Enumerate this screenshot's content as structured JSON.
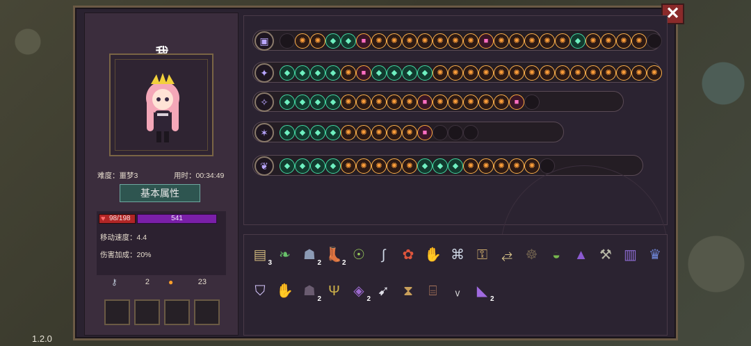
{
  "app": {
    "version": "1.2.0"
  },
  "header": {
    "player_name": "我"
  },
  "close": {
    "label": "✕"
  },
  "run_info": {
    "difficulty": "难度：噩梦3",
    "elapsed": "用时：00:34:49"
  },
  "attributes": {
    "title": "基本属性",
    "hp": "98/198",
    "mp": "541",
    "move_speed": "移动速度：4.4",
    "damage_bonus": "伤害加成：20%"
  },
  "resources": {
    "keys": "2",
    "coins": "23"
  },
  "colors": {
    "panel_bg": "#2a2230",
    "hp": "#b12626",
    "mp": "#7a1fa8",
    "accent_teal": "#2e5550"
  },
  "weapons": [
    {
      "icon": "chest-icon",
      "slots": 25
    },
    {
      "icon": "staff-icon",
      "slots": 25
    },
    {
      "icon": "wand-icon",
      "slots": 17
    },
    {
      "icon": "dark-wand-icon",
      "slots": 13
    },
    {
      "icon": "nature-staff-icon",
      "slots": 18
    }
  ],
  "items": [
    {
      "icon": "armor-chest-icon",
      "count": "3"
    },
    {
      "icon": "leaf-icon",
      "count": ""
    },
    {
      "icon": "cloak-icon",
      "count": "2"
    },
    {
      "icon": "boots-icon",
      "count": "2"
    },
    {
      "icon": "helmet-icon",
      "count": ""
    },
    {
      "icon": "horn-icon",
      "count": ""
    },
    {
      "icon": "rune-red-icon",
      "count": ""
    },
    {
      "icon": "green-hand-icon",
      "count": ""
    },
    {
      "icon": "scroll-icon",
      "count": ""
    },
    {
      "icon": "key-icon",
      "count": ""
    },
    {
      "icon": "spoon-icon",
      "count": ""
    },
    {
      "icon": "bag-icon",
      "count": ""
    },
    {
      "icon": "slime-icon",
      "count": ""
    },
    {
      "icon": "witch-hat-icon",
      "count": ""
    },
    {
      "icon": "hammer-icon",
      "count": ""
    },
    {
      "icon": "tome-icon",
      "count": ""
    },
    {
      "icon": "crown-icon",
      "count": ""
    },
    {
      "icon": "shield-icon",
      "count": ""
    },
    {
      "icon": "gloves-icon",
      "count": ""
    },
    {
      "icon": "armor-dark-icon",
      "count": "2"
    },
    {
      "icon": "antler-icon",
      "count": ""
    },
    {
      "icon": "map-icon",
      "count": "2"
    },
    {
      "icon": "wing-icon",
      "count": ""
    },
    {
      "icon": "hourglass-icon",
      "count": ""
    },
    {
      "icon": "drum-icon",
      "count": ""
    },
    {
      "icon": "fang-icon",
      "count": ""
    },
    {
      "icon": "crystal-icon",
      "count": "2"
    }
  ]
}
